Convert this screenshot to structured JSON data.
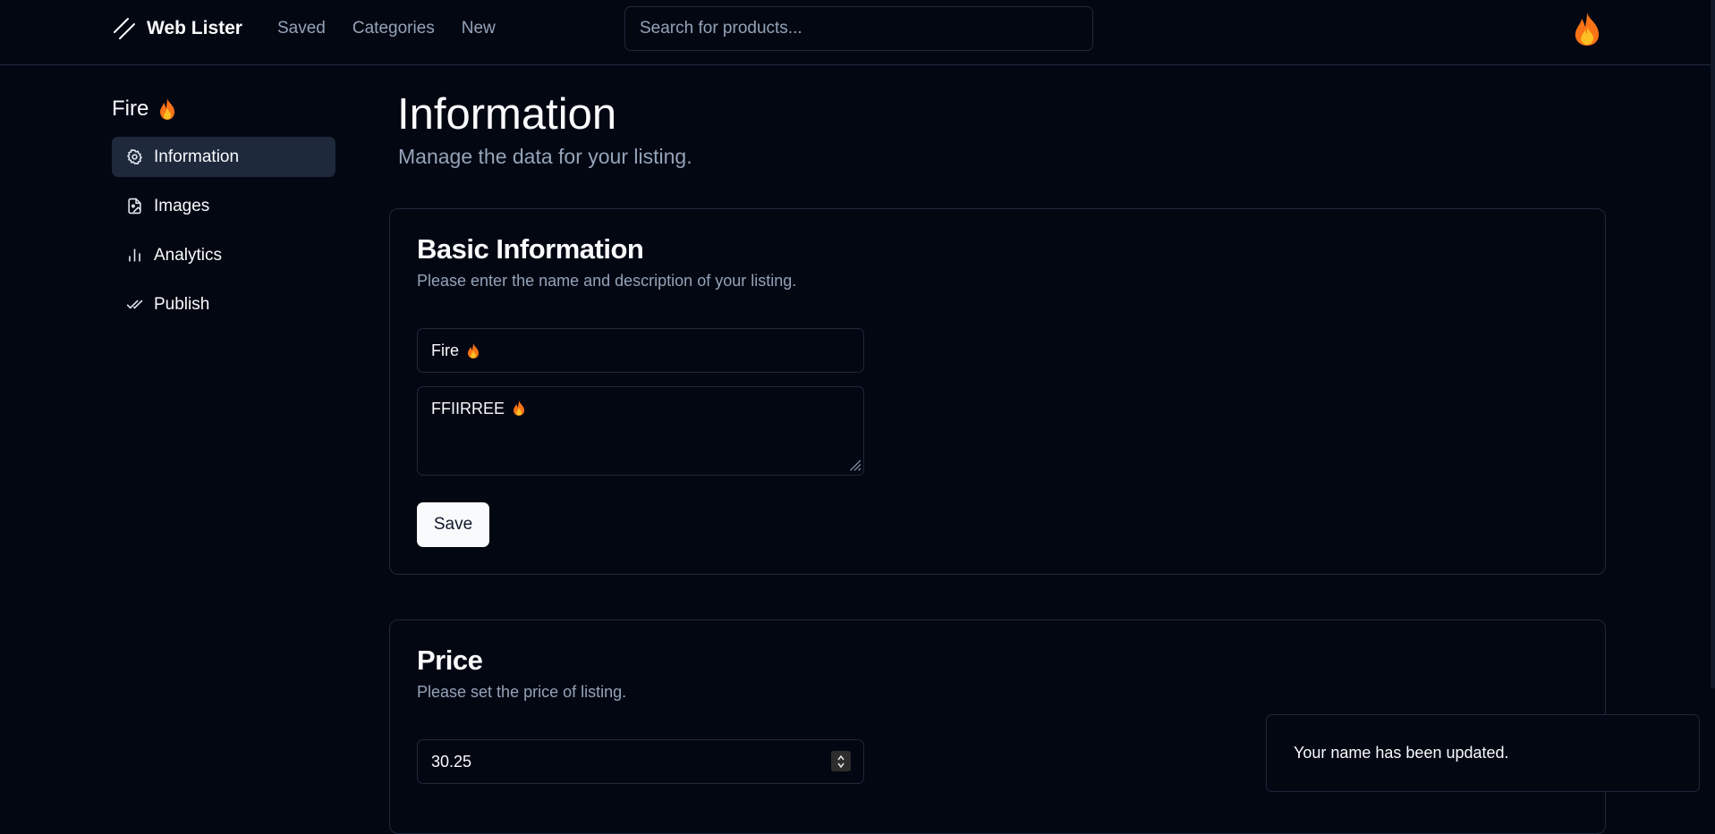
{
  "app": {
    "name": "Web Lister"
  },
  "nav": {
    "items": [
      "Saved",
      "Categories",
      "New"
    ]
  },
  "search": {
    "placeholder": "Search for products...",
    "value": ""
  },
  "sidebar": {
    "title": "Fire",
    "items": [
      {
        "label": "Information",
        "icon": "gear-icon",
        "active": true
      },
      {
        "label": "Images",
        "icon": "image-file-icon",
        "active": false
      },
      {
        "label": "Analytics",
        "icon": "bar-chart-icon",
        "active": false
      },
      {
        "label": "Publish",
        "icon": "double-check-icon",
        "active": false
      }
    ]
  },
  "page": {
    "title": "Information",
    "subtitle": "Manage the data for your listing."
  },
  "basic": {
    "title": "Basic Information",
    "description": "Please enter the name and description of your listing.",
    "name_value": "Fire",
    "description_value": "FFIIRREE",
    "save_label": "Save"
  },
  "price": {
    "title": "Price",
    "description": "Please set the price of listing.",
    "value": "30.25"
  },
  "toast": {
    "message": "Your name has been updated."
  },
  "colors": {
    "background": "#030712",
    "border": "#1e293b",
    "muted_text": "#94a3b8",
    "active_item": "#1e293b",
    "button_bg": "#f8fafc",
    "fire": "#f97316"
  }
}
